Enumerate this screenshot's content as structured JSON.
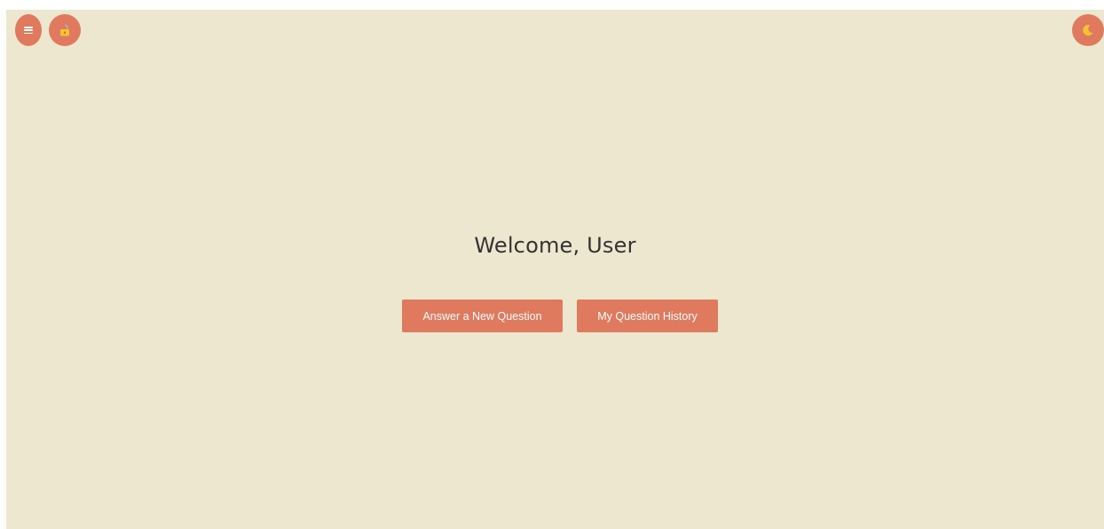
{
  "header": {
    "menu_icon": "hamburger-icon",
    "lock_icon": "open-lock-icon",
    "theme_icon": "crescent-moon-icon"
  },
  "main": {
    "welcome_text": "Welcome, User",
    "answer_button_label": "Answer a New Question",
    "history_button_label": "My Question History"
  },
  "colors": {
    "background": "#ede7d0",
    "accent": "#e07a5f",
    "text": "#333333",
    "icon_yellow": "#f4c430"
  }
}
